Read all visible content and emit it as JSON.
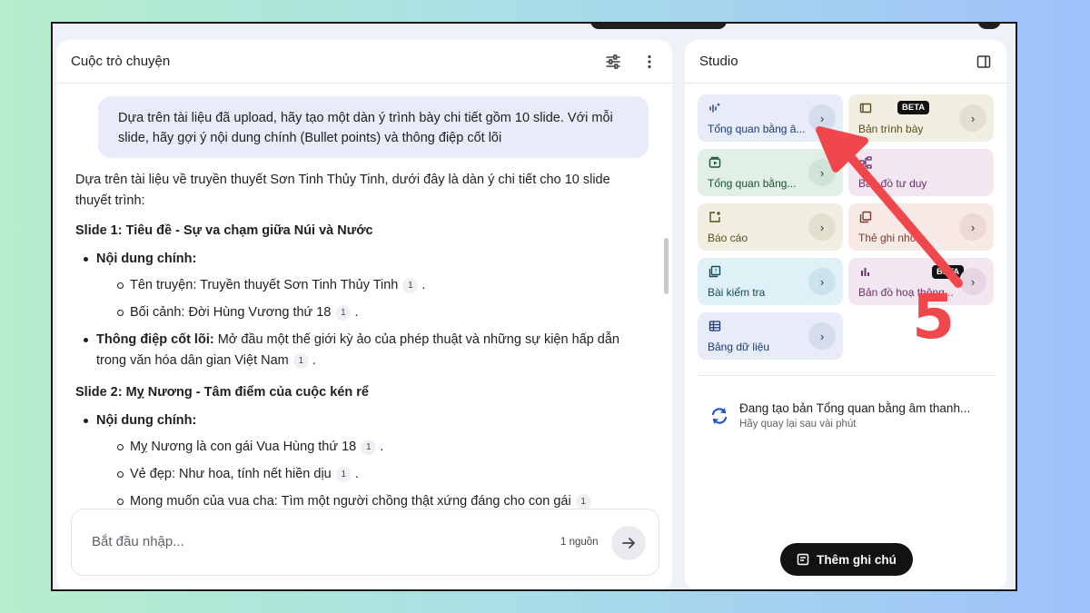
{
  "chat": {
    "title": "Cuộc trò chuyện",
    "user_message": "Dựa trên tài liệu đã upload, hãy tạo một dàn ý trình bày chi tiết gồm 10 slide. Với mỗi slide, hãy gợi ý nội dung chính (Bullet points) và thông điệp cốt lõi",
    "intro": "Dựa trên tài liệu về truyền thuyết Sơn Tinh Thủy Tinh, dưới đây là dàn ý chi tiết cho 10 slide thuyết trình:",
    "slide1": {
      "heading": "Slide 1: Tiêu đề - Sự va chạm giữa Núi và Nước",
      "content_label": "Nội dung chính:",
      "item1": "Tên truyện: Truyền thuyết Sơn Tinh Thủy Tinh",
      "item2": "Bối cảnh: Đời Hùng Vương thứ 18",
      "message_label": "Thông điệp cốt lõi:",
      "message_text": " Mở đầu một thế giới kỳ ảo của phép thuật và những sự kiện hấp dẫn trong văn hóa dân gian Việt Nam"
    },
    "slide2": {
      "heading": "Slide 2: Mỵ Nương - Tâm điểm của cuộc kén rể",
      "content_label": "Nội dung chính:",
      "item1": "Mỵ Nương là con gái Vua Hùng thứ 18",
      "item2": "Vẻ đẹp: Như hoa, tính nết hiền dịu",
      "item3": "Mong muốn của vua cha: Tìm một người chồng thật xứng đáng cho con gái"
    },
    "citation": "1",
    "input_placeholder": "Bắt đầu nhập...",
    "source_count": "1 nguồn"
  },
  "studio": {
    "title": "Studio",
    "tiles": [
      {
        "label": "Tổng quan bằng â...",
        "icon": "audio-overview-icon"
      },
      {
        "label": "Bản trình bày",
        "icon": "slides-icon",
        "badge": "BETA"
      },
      {
        "label": "Tổng quan bằng...",
        "icon": "video-overview-icon"
      },
      {
        "label": "Bản đồ tư duy",
        "icon": "mind-map-icon"
      },
      {
        "label": "Báo cáo",
        "icon": "report-icon"
      },
      {
        "label": "Thẻ ghi nhớ",
        "icon": "flashcards-icon"
      },
      {
        "label": "Bài kiểm tra",
        "icon": "quiz-icon"
      },
      {
        "label": "Bản đồ hoạ thông...",
        "icon": "infographic-icon",
        "badge": "BETA"
      },
      {
        "label": "Bảng dữ liệu",
        "icon": "data-table-icon"
      }
    ],
    "generating_title": "Đang tạo bản Tổng quan bằng âm thanh...",
    "generating_subtitle": "Hãy quay lại sau vài phút",
    "add_note_label": "Thêm ghi chú"
  },
  "annotation": {
    "step_number": "5",
    "color": "#f0474c"
  }
}
